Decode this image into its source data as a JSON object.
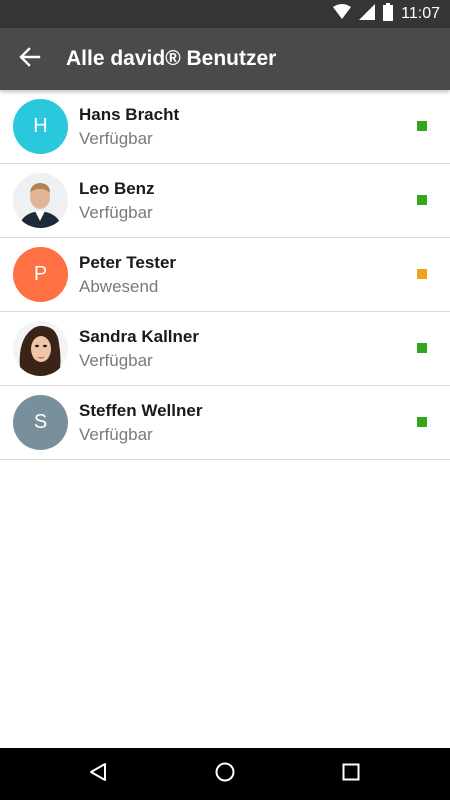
{
  "status_bar": {
    "time": "11:07",
    "icons": [
      "wifi-icon",
      "signal-icon",
      "battery-icon"
    ]
  },
  "app_bar": {
    "title": "Alle david® Benutzer",
    "back_icon": "arrow-back-icon"
  },
  "colors": {
    "status_bar": "#353535",
    "app_bar": "#4a4a4a",
    "available": "#34a61b",
    "away": "#f0a11f"
  },
  "users": [
    {
      "name": "Hans Bracht",
      "status": "Verfügbar",
      "avatar_letter": "H",
      "avatar_color": "#29c8dd",
      "presence_color": "#34a61b"
    },
    {
      "name": "Leo Benz",
      "status": "Verfügbar",
      "avatar_letter": "",
      "avatar_color": "",
      "presence_color": "#34a61b"
    },
    {
      "name": "Peter Tester",
      "status": "Abwesend",
      "avatar_letter": "P",
      "avatar_color": "#ff7043",
      "presence_color": "#f0a11f"
    },
    {
      "name": "Sandra Kallner",
      "status": "Verfügbar",
      "avatar_letter": "",
      "avatar_color": "",
      "presence_color": "#34a61b"
    },
    {
      "name": "Steffen Wellner",
      "status": "Verfügbar",
      "avatar_letter": "S",
      "avatar_color": "#78909c",
      "presence_color": "#34a61b"
    }
  ],
  "nav_bar": {
    "icons": [
      "back-triangle-icon",
      "home-circle-icon",
      "recents-square-icon"
    ]
  }
}
